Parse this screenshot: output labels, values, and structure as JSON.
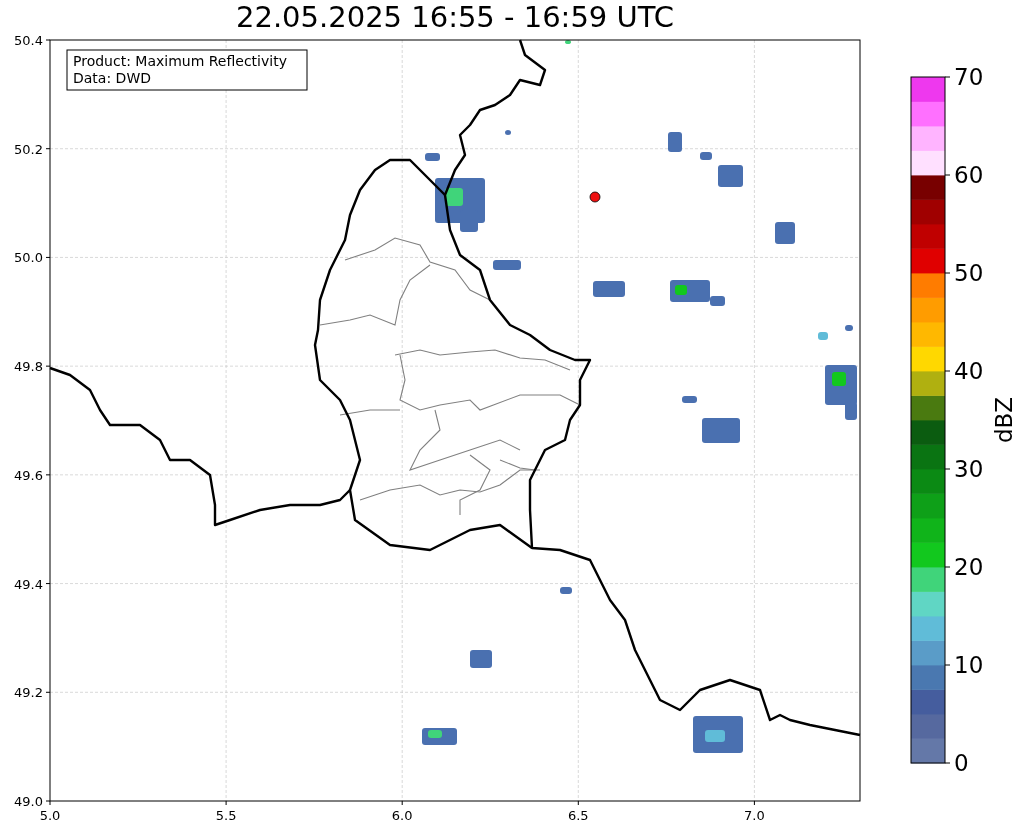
{
  "title": "22.05.2025 16:55 - 16:59 UTC",
  "map": {
    "info_box": [
      "Product: Maximum Reflectivity",
      "Data: DWD"
    ],
    "x_ticks": [
      "5.0",
      "5.5",
      "6.0",
      "6.5",
      "7.0"
    ],
    "y_ticks": [
      "50.4",
      "50.2",
      "50.0",
      "49.8",
      "49.6",
      "49.4",
      "49.2",
      "49.0"
    ]
  },
  "colorbar": {
    "label": "dBZ",
    "ticks": [
      "70",
      "60",
      "50",
      "40",
      "30",
      "20",
      "10",
      "0"
    ],
    "segments": [
      {
        "color": "#6478a8"
      },
      {
        "color": "#56699f"
      },
      {
        "color": "#455d9e"
      },
      {
        "color": "#4a78b0"
      },
      {
        "color": "#5a9cc8"
      },
      {
        "color": "#60bcd8"
      },
      {
        "color": "#60d6c4"
      },
      {
        "color": "#40d47a"
      },
      {
        "color": "#12c81e"
      },
      {
        "color": "#10b41a"
      },
      {
        "color": "#0ea018"
      },
      {
        "color": "#0b8a14"
      },
      {
        "color": "#0a7412"
      },
      {
        "color": "#0b5c10"
      },
      {
        "color": "#4a7a10"
      },
      {
        "color": "#b0b010"
      },
      {
        "color": "#ffd800"
      },
      {
        "color": "#ffb800"
      },
      {
        "color": "#ff9c00"
      },
      {
        "color": "#ff7c00"
      },
      {
        "color": "#e00000"
      },
      {
        "color": "#c00000"
      },
      {
        "color": "#a00000"
      },
      {
        "color": "#780000"
      },
      {
        "color": "#ffe0ff"
      },
      {
        "color": "#ffb4ff"
      },
      {
        "color": "#ff70ff"
      },
      {
        "color": "#ee38ee"
      }
    ]
  }
}
